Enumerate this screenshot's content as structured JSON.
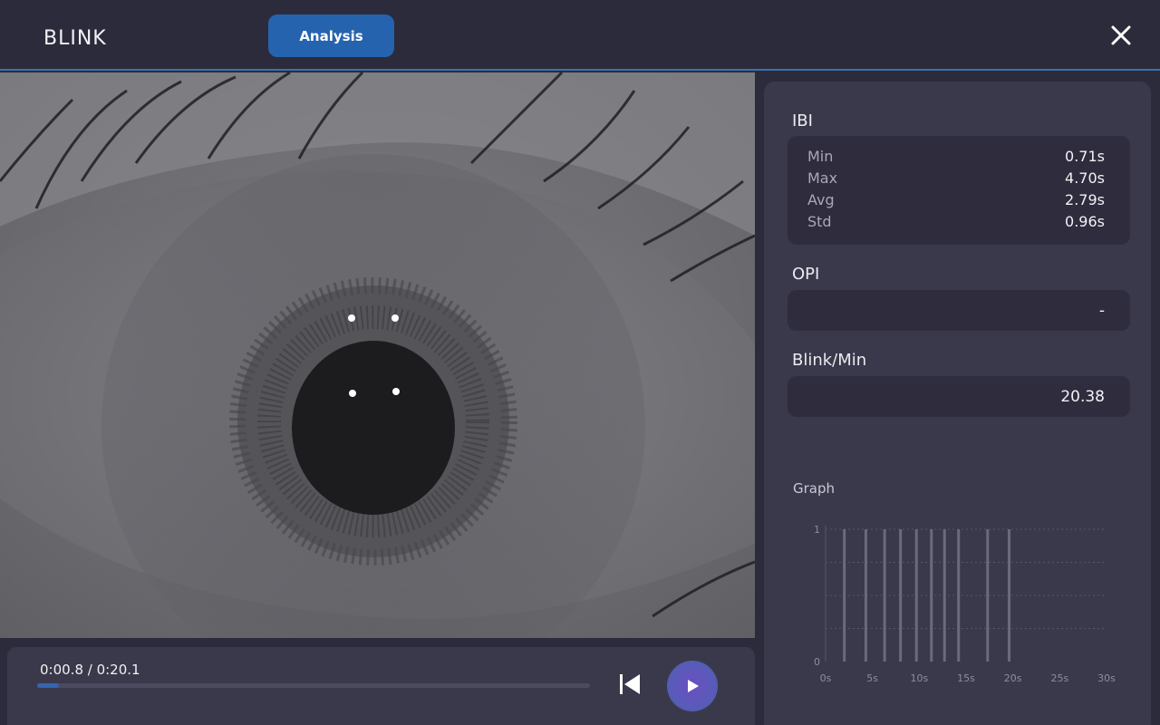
{
  "header": {
    "app_title": "BLINK",
    "analysis_button": "Analysis",
    "close_icon": "close-icon"
  },
  "player": {
    "timecode": "0:00.8 / 0:20.1",
    "progress": 0.04,
    "restart_icon": "skip-to-start-icon",
    "play_icon": "play-icon"
  },
  "panel": {
    "ibi": {
      "title": "IBI",
      "rows": [
        {
          "label": "Min",
          "value": "0.71s"
        },
        {
          "label": "Max",
          "value": "4.70s"
        },
        {
          "label": "Avg",
          "value": "2.79s"
        },
        {
          "label": "Std",
          "value": "0.96s"
        }
      ]
    },
    "opi": {
      "title": "OPI",
      "value": "-"
    },
    "blink_per_min": {
      "title": "Blink/Min",
      "value": "20.38"
    },
    "graph_title": "Graph"
  },
  "chart_data": {
    "type": "bar",
    "x_ticks": [
      "0s",
      "5s",
      "10s",
      "15s",
      "20s",
      "25s",
      "30s"
    ],
    "y_ticks": [
      "0",
      "1"
    ],
    "xlim": [
      0,
      30
    ],
    "ylim": [
      0,
      1
    ],
    "blink_times": [
      2.0,
      4.3,
      6.3,
      8.0,
      9.7,
      11.3,
      12.7,
      14.2,
      17.3,
      19.6
    ],
    "colors": {
      "bar": "#6a6a7c",
      "grid": "#55546a"
    }
  }
}
